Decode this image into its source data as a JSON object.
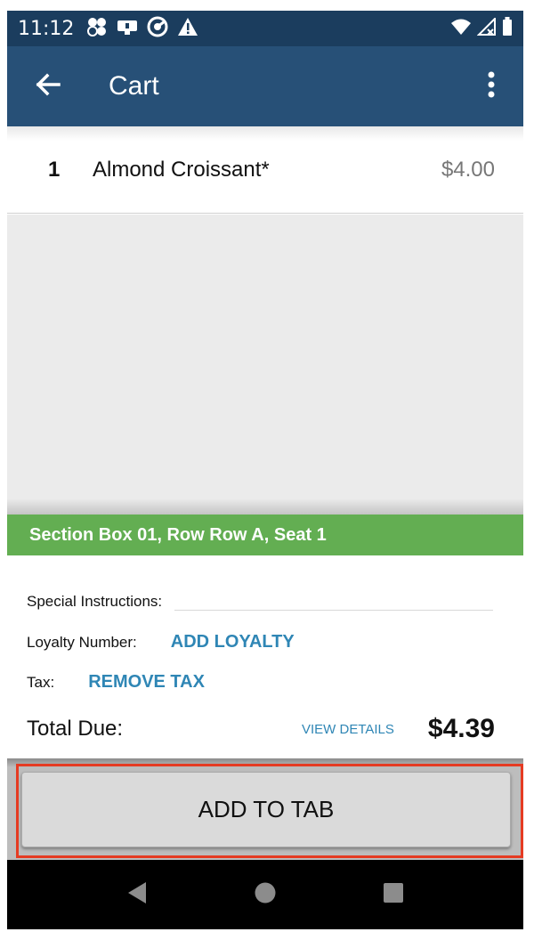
{
  "status_bar": {
    "time": "11:12",
    "icons_left": [
      "clover-icon",
      "cast-icon",
      "vpn-icon",
      "alert-icon"
    ],
    "icons_right": [
      "wifi-icon",
      "signal-icon",
      "battery-icon"
    ]
  },
  "app_bar": {
    "title": "Cart"
  },
  "cart": {
    "items": [
      {
        "qty": "1",
        "name": "Almond Croissant*",
        "price": "$4.00"
      }
    ]
  },
  "seat": {
    "text": "Section Box 01, Row Row A, Seat 1"
  },
  "details": {
    "special_label": "Special Instructions:",
    "special_value": "",
    "loyalty_label": "Loyalty Number:",
    "loyalty_action": "ADD LOYALTY",
    "tax_label": "Tax:",
    "tax_action": "REMOVE TAX",
    "total_label": "Total Due:",
    "view_details": "VIEW DETAILS",
    "total_value": "$4.39"
  },
  "footer": {
    "add_to_tab": "ADD TO TAB"
  },
  "colors": {
    "status_bar": "#1b3d5e",
    "app_bar": "#275077",
    "seat_bar": "#63ae52",
    "link": "#2f86b5",
    "highlight": "#e53b22"
  }
}
